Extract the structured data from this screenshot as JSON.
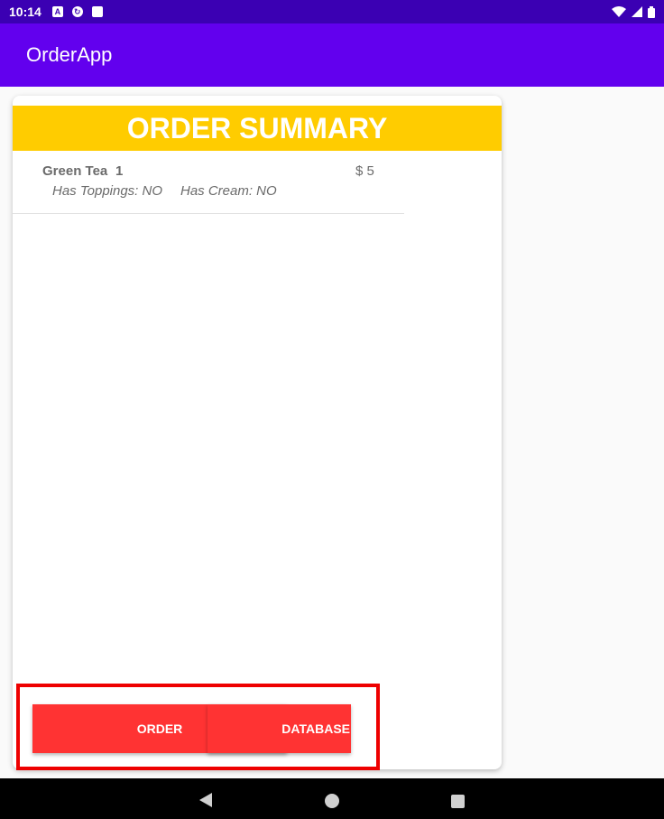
{
  "status_bar": {
    "time": "10:14",
    "left_icons": [
      "text-a-icon",
      "refresh-icon",
      "sd-card-icon"
    ],
    "right_icons": [
      "wifi-icon",
      "signal-icon",
      "battery-icon"
    ]
  },
  "app_bar": {
    "title": "OrderApp"
  },
  "summary": {
    "title": "ORDER SUMMARY",
    "items": [
      {
        "name": "Green Tea",
        "quantity": "1",
        "price": "$ 5",
        "toppings": "Has Toppings: NO",
        "cream": "Has Cream: NO"
      }
    ]
  },
  "actions": {
    "order_label": "ORDER",
    "database_label": "DATABASE"
  },
  "nav": {
    "icons": [
      "back-icon",
      "home-icon",
      "recents-icon"
    ]
  },
  "colors": {
    "status_bar": "#3b00b3",
    "app_bar": "#6200ee",
    "header": "#ffcc00",
    "button": "#ff3333",
    "highlight": "#ee0000"
  }
}
